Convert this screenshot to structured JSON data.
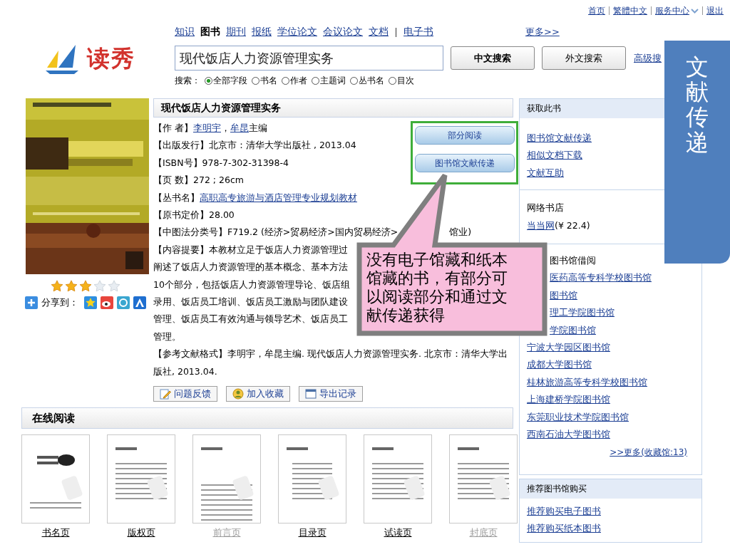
{
  "top_links": [
    {
      "label": "首页",
      "kind": "link"
    },
    {
      "label": "繁體中文",
      "kind": "link"
    },
    {
      "label": "服务中心",
      "kind": "menu"
    },
    {
      "label": "退出",
      "kind": "link"
    }
  ],
  "logo": {
    "text": "读秀"
  },
  "nav": {
    "tabs": [
      {
        "label": "知识",
        "selected": false
      },
      {
        "label": "图书",
        "selected": true
      },
      {
        "label": "期刊",
        "selected": false
      },
      {
        "label": "报纸",
        "selected": false
      },
      {
        "label": "学位论文",
        "selected": false
      },
      {
        "label": "会议论文",
        "selected": false
      },
      {
        "label": "文档",
        "selected": false
      },
      {
        "label": "电子书",
        "selected": false
      }
    ],
    "more": "更多>>"
  },
  "search": {
    "value": "现代饭店人力资源管理实务",
    "buttons": [
      "中文搜索",
      "外文搜索"
    ],
    "advanced": "高级搜",
    "scope_label": "搜索：",
    "scopes": [
      {
        "label": "全部字段",
        "selected": true
      },
      {
        "label": "书名",
        "selected": false
      },
      {
        "label": "作者",
        "selected": false
      },
      {
        "label": "主题词",
        "selected": false
      },
      {
        "label": "丛书名",
        "selected": false
      },
      {
        "label": "目次",
        "selected": false
      }
    ]
  },
  "book": {
    "title": "现代饭店人力资源管理实务",
    "stars": 3,
    "share_label": "分享到：",
    "fields": [
      {
        "label": "【作 者】",
        "parts": [
          {
            "text": "李明宇",
            "link": true
          },
          {
            "text": "，",
            "link": false
          },
          {
            "text": "牟昆",
            "link": true
          },
          {
            "text": "主编",
            "link": false
          }
        ]
      },
      {
        "label": "【出版发行】",
        "parts": [
          {
            "text": "北京市：清华大学出版社 , 2013.04",
            "link": false
          }
        ]
      },
      {
        "label": "【ISBN号】",
        "parts": [
          {
            "text": "978-7-302-31398-4",
            "link": false
          }
        ]
      },
      {
        "label": "【页 数】",
        "parts": [
          {
            "text": "272 ; 26cm",
            "link": false
          }
        ]
      },
      {
        "label": "【丛书名】",
        "parts": [
          {
            "text": "高职高专旅游与酒店管理专业规划教材",
            "link": true
          }
        ]
      },
      {
        "label": "【原书定价】",
        "parts": [
          {
            "text": "28.00",
            "link": false
          }
        ]
      },
      {
        "label": "【中图法分类号】",
        "parts": [
          {
            "text": "F719.2 (经济>贸易经济>国内贸易经济>",
            "link": false
          },
          {
            "text": "馆业)",
            "link": false,
            "kind": "after_gap"
          }
        ]
      }
    ],
    "summary_label": "【内容提要】",
    "summary_lines": [
      "本教材立足于饭店人力资源管理过",
      "阐述了饭店人力资源管理的基本概念、基本方法",
      "10个部分，包括饭店人力资源管理导论、饭店组",
      "录用、饭店员工培训、饭店员工激励与团队建设",
      "管理、饭店员工有效沟通与领导艺术、饭店员工",
      "管理。"
    ],
    "reference_label": "【参考文献格式】",
    "reference": "李明宇，牟昆主编. 现代饭店人力资源管理实务. 北京市：清华大学出版社, 2013.04.",
    "access_buttons": [
      "部分阅读",
      "图书馆文献传递"
    ],
    "actions": [
      {
        "label": "问题反馈",
        "kind": "feedback"
      },
      {
        "label": "加入收藏",
        "kind": "favorite"
      },
      {
        "label": "导出记录",
        "kind": "export"
      }
    ]
  },
  "online_reading": {
    "title": "在线阅读",
    "pages": [
      {
        "caption": "书名页",
        "disabled": false
      },
      {
        "caption": "版权页",
        "disabled": false
      },
      {
        "caption": "前言页",
        "disabled": true
      },
      {
        "caption": "目录页",
        "disabled": false
      },
      {
        "caption": "试读页",
        "disabled": false
      },
      {
        "caption": "封底页",
        "disabled": true
      }
    ]
  },
  "get_book": {
    "title": "获取此书",
    "links": [
      "图书馆文献传递",
      "相似文档下载",
      "文献互助"
    ]
  },
  "store": {
    "title": "网络书店",
    "link": "当当网",
    "price": "(¥ 22.4)"
  },
  "libraries": {
    "heading": {
      "text": "图书馆借阅",
      "kind": "partial"
    },
    "items": [
      {
        "name": "医药高等专科学校图书馆",
        "kind": "partial"
      },
      {
        "name": "图书馆",
        "kind": "partial"
      },
      {
        "name": "理工学院图书馆",
        "kind": "partial"
      },
      {
        "name": "学院图书馆",
        "kind": "partial"
      },
      {
        "name": "宁波大学园区图书馆",
        "kind": "full"
      },
      {
        "name": "成都大学图书馆",
        "kind": "full"
      },
      {
        "name": "桂林旅游高等专科学校图书馆",
        "kind": "full"
      },
      {
        "name": "上海建桥学院图书馆",
        "kind": "full"
      },
      {
        "name": "东莞职业技术学院图书馆",
        "kind": "full"
      },
      {
        "name": "西南石油大学图书馆",
        "kind": "full"
      }
    ],
    "more": ">>更多(收藏馆:13)"
  },
  "recommend": {
    "title": "推荐图书馆购买",
    "links": [
      "推荐购买电子图书",
      "推荐购买纸本图书"
    ]
  },
  "callout": {
    "lines": [
      "没有电子馆藏和纸本",
      "馆藏的书，有部分可",
      "以阅读部分和通过文",
      "献传递获得"
    ]
  },
  "side_tab": {
    "text": "文献传递"
  }
}
